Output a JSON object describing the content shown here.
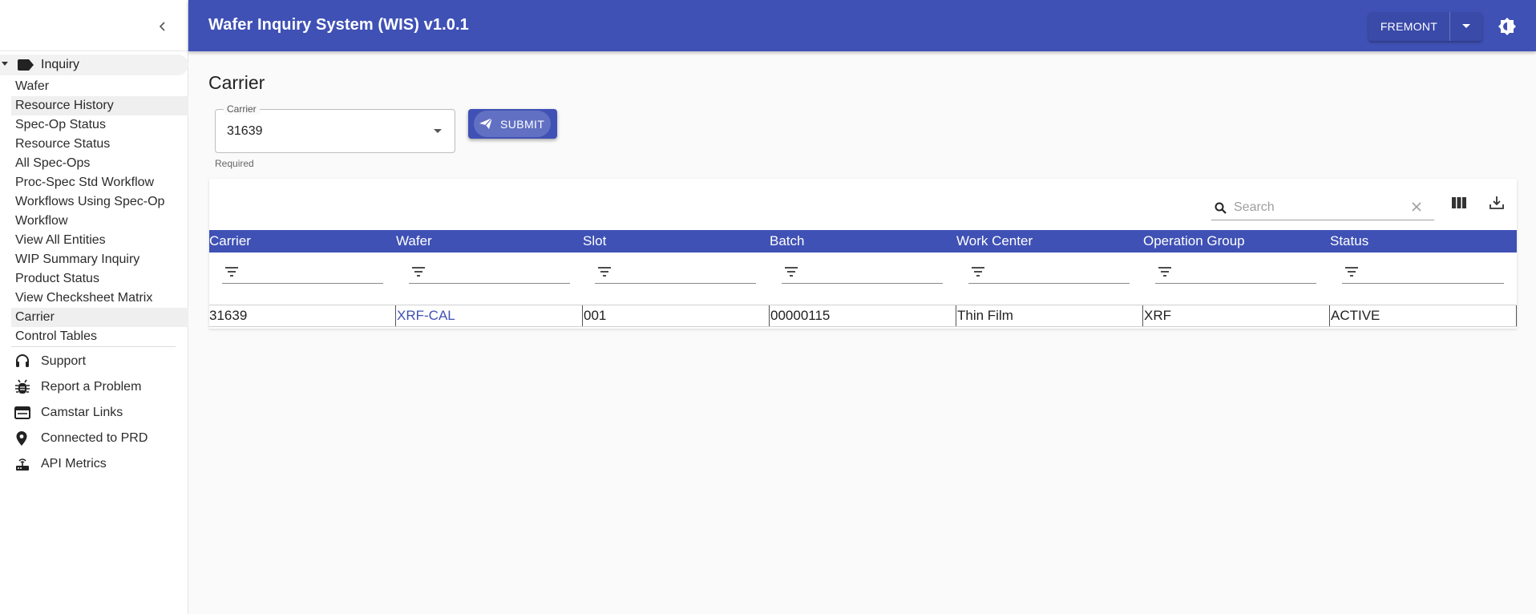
{
  "app": {
    "title": "Wafer Inquiry System (WIS) v1.0.1"
  },
  "header": {
    "site_button": "FREMONT",
    "icons": [
      "chevron-left-icon",
      "arrow-drop-down-icon",
      "brightness-icon"
    ]
  },
  "sidebar": {
    "group": {
      "label": "Inquiry",
      "icon": "label-tag-icon"
    },
    "items": [
      {
        "label": "Wafer"
      },
      {
        "label": "Resource History"
      },
      {
        "label": "Spec-Op Status"
      },
      {
        "label": "Resource Status"
      },
      {
        "label": "All Spec-Ops"
      },
      {
        "label": "Proc-Spec Std Workflow"
      },
      {
        "label": "Workflows Using Spec-Op"
      },
      {
        "label": "Workflow"
      },
      {
        "label": "View All Entities"
      },
      {
        "label": "WIP Summary Inquiry"
      },
      {
        "label": "Product Status"
      },
      {
        "label": "View Checksheet Matrix"
      },
      {
        "label": "Carrier"
      },
      {
        "label": "Control Tables"
      }
    ],
    "extra": [
      {
        "label": "Support",
        "icon": "headset-icon"
      },
      {
        "label": "Report a Problem",
        "icon": "bug-icon"
      },
      {
        "label": "Camstar Links",
        "icon": "web-window-icon"
      },
      {
        "label": "Connected to PRD",
        "icon": "location-pin-icon"
      },
      {
        "label": "API Metrics",
        "icon": "router-icon"
      }
    ]
  },
  "main": {
    "page_title": "Carrier",
    "carrier_field": {
      "label": "Carrier",
      "value": "31639",
      "helper": "Required"
    },
    "submit_label": "SUBMIT"
  },
  "table": {
    "search_placeholder": "Search",
    "columns": [
      "Carrier",
      "Wafer",
      "Slot",
      "Batch",
      "Work Center",
      "Operation Group",
      "Status"
    ],
    "rows": [
      [
        "31639",
        "XRF-CAL",
        "001",
        "00000115",
        "Thin Film",
        "XRF",
        "ACTIVE"
      ]
    ]
  },
  "colors": {
    "primary": "#3f51b5",
    "link": "#3f51b5",
    "background": "#fafafa"
  }
}
